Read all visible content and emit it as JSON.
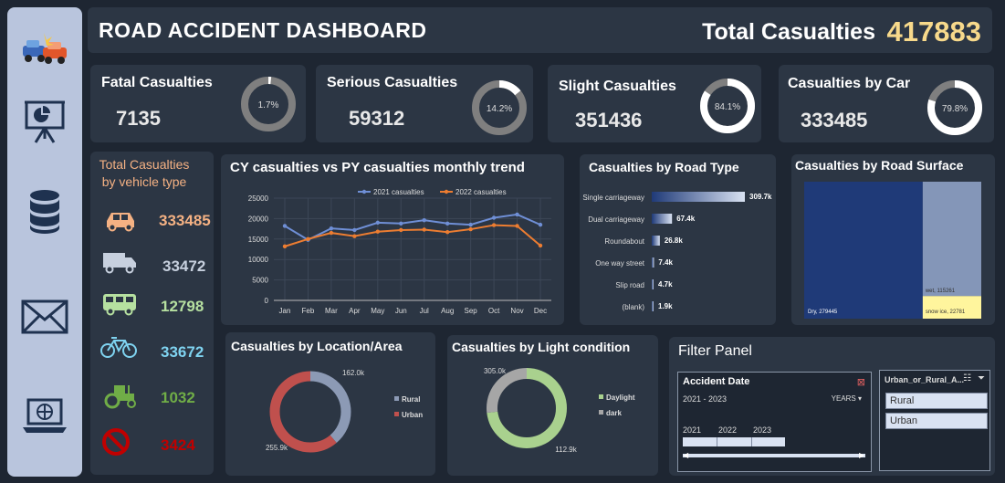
{
  "header": {
    "title": "ROAD ACCIDENT DASHBOARD",
    "total_label": "Total Casualties",
    "total_value": "417883"
  },
  "sidebar": {
    "icons": [
      "car-crash-icon",
      "presentation-icon",
      "database-icon",
      "mail-icon",
      "laptop-icon"
    ]
  },
  "kpis": [
    {
      "label": "Fatal Casualties",
      "value": "7135",
      "pct_label": "1.7%",
      "pct": 1.7
    },
    {
      "label": "Serious Casualties",
      "value": "59312",
      "pct_label": "14.2%",
      "pct": 14.2
    },
    {
      "label": "Slight Casualties",
      "value": "351436",
      "pct_label": "84.1%",
      "pct": 84.1
    },
    {
      "label": "Casualties by Car",
      "value": "333485",
      "pct_label": "79.8%",
      "pct": 79.8
    }
  ],
  "vehicle": {
    "title1": "Total Casualties",
    "title2": "by vehicle type",
    "items": [
      {
        "icon": "car-icon",
        "value": "333485",
        "color": "#f4b183"
      },
      {
        "icon": "truck-icon",
        "value": "33472",
        "color": "#c7d0de"
      },
      {
        "icon": "bus-icon",
        "value": "12798",
        "color": "#b6e0a0"
      },
      {
        "icon": "bicycle-icon",
        "value": "33672",
        "color": "#7fd3f0"
      },
      {
        "icon": "tractor-icon",
        "value": "1032",
        "color": "#70ad47"
      },
      {
        "icon": "prohibited-icon",
        "value": "3424",
        "color": "#c00000"
      }
    ]
  },
  "chart_data": [
    {
      "type": "line",
      "title": "CY casualties vs PY casualties monthly trend",
      "categories": [
        "Jan",
        "Feb",
        "Mar",
        "Apr",
        "May",
        "Jun",
        "Jul",
        "Aug",
        "Sep",
        "Oct",
        "Nov",
        "Dec"
      ],
      "ylim": [
        0,
        25000
      ],
      "yticks": [
        "0",
        "5000",
        "10000",
        "15000",
        "20000",
        "25000"
      ],
      "series": [
        {
          "name": "2021 casualties",
          "color": "#6f8fd6",
          "values": [
            18200,
            14800,
            17600,
            17200,
            19000,
            18800,
            19600,
            18800,
            18500,
            20200,
            21000,
            18500
          ]
        },
        {
          "name": "2022 casualties",
          "color": "#ed7d31",
          "values": [
            13200,
            15000,
            16500,
            15700,
            16800,
            17200,
            17300,
            16700,
            17400,
            18400,
            18200,
            13400
          ]
        }
      ]
    },
    {
      "type": "bar",
      "title": "Casualties by Road Type",
      "categories": [
        "Single carriageway",
        "Dual carriageway",
        "Roundabout",
        "One way street",
        "Slip road",
        "(blank)"
      ],
      "values": [
        309.7,
        67.4,
        26.8,
        7.4,
        4.7,
        1.9
      ],
      "labels": [
        "309.7k",
        "67.4k",
        "26.8k",
        "7.4k",
        "4.7k",
        "1.9k"
      ]
    },
    {
      "type": "heatmap",
      "title": "Casualties by Road Surface",
      "categories": [
        "Dry",
        "wet",
        "snow ice"
      ],
      "values": [
        279445,
        115261,
        22781
      ],
      "labels": [
        "Dry, 279445",
        "wet, 115261",
        "snow ice, 22781"
      ],
      "colors": [
        "#1f3a78",
        "#8496b8",
        "#fff59d"
      ]
    },
    {
      "type": "pie",
      "title": "Casualties by Location/Area",
      "categories": [
        "Rural",
        "Urban"
      ],
      "values": [
        162.0,
        255.9
      ],
      "labels": [
        "162.0k",
        "255.9k"
      ],
      "colors": [
        "#8c9ab5",
        "#c0504d"
      ]
    },
    {
      "type": "pie",
      "title": "Casualties by Light condition",
      "categories": [
        "Daylight",
        "dark"
      ],
      "values": [
        305.0,
        112.9
      ],
      "labels": [
        "305.0k",
        "112.9k"
      ],
      "colors": [
        "#a9d18e",
        "#a6a6a6"
      ]
    }
  ],
  "filter": {
    "title": "Filter Panel",
    "date_label": "Accident Date",
    "date_range": "2021 - 2023",
    "date_level": "YEARS",
    "years": [
      "2021",
      "2022",
      "2023"
    ],
    "area_label": "Urban_or_Rural_A...",
    "area_options": [
      "Rural",
      "Urban"
    ]
  }
}
